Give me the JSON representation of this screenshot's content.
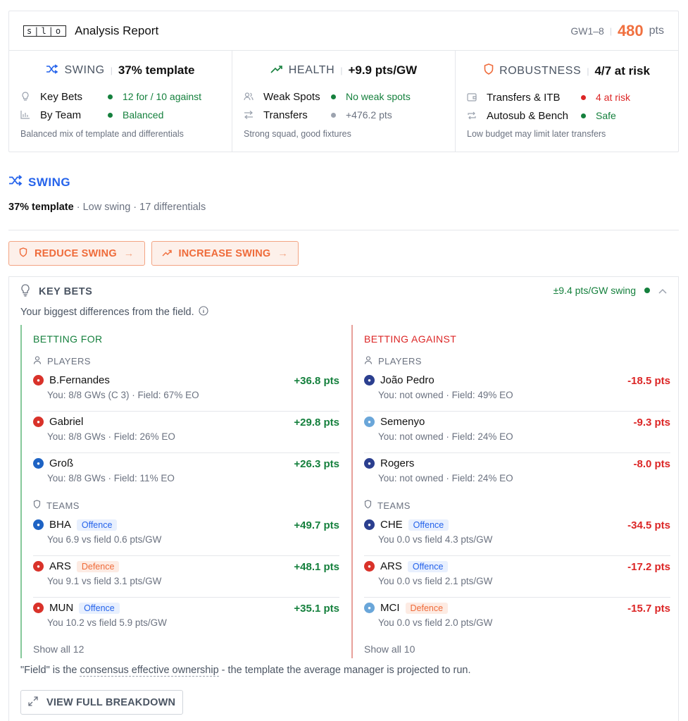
{
  "header": {
    "logo_text": "s|l|o",
    "title": "Analysis Report",
    "gw_range": "GW1–8",
    "points": "480",
    "points_unit": "pts"
  },
  "metrics": [
    {
      "label": "SWING",
      "value": "37% template",
      "color": "#2563eb",
      "rows": [
        {
          "label": "Key Bets",
          "value": "12 for / 10 against",
          "status": "#15803d",
          "value_color": "#15803d"
        },
        {
          "label": "By Team",
          "value": "Balanced",
          "status": "#15803d",
          "value_color": "#15803d"
        }
      ],
      "footer": "Balanced mix of template and differentials"
    },
    {
      "label": "HEALTH",
      "value": "+9.9 pts/GW",
      "color": "#15803d",
      "rows": [
        {
          "label": "Weak Spots",
          "value": "No weak spots",
          "status": "#15803d",
          "value_color": "#15803d"
        },
        {
          "label": "Transfers",
          "value": "+476.2 pts",
          "status": "#9ca3af",
          "value_color": "#6b7280"
        }
      ],
      "footer": "Strong squad, good fixtures"
    },
    {
      "label": "ROBUSTNESS",
      "value": "4/7 at risk",
      "color": "#ef6b3a",
      "rows": [
        {
          "label": "Transfers & ITB",
          "value": "4 at risk",
          "status": "#dc2626",
          "value_color": "#dc2626"
        },
        {
          "label": "Autosub & Bench",
          "value": "Safe",
          "status": "#15803d",
          "value_color": "#15803d"
        }
      ],
      "footer": "Low budget may limit later transfers"
    }
  ],
  "swing_section": {
    "title": "SWING",
    "summary_bold": "37% template",
    "summary_rest": " · Low swing · 17 differentials",
    "reduce_label": "REDUCE SWING",
    "increase_label": "INCREASE SWING"
  },
  "key_bets": {
    "title": "KEY BETS",
    "swing_value": "±9.4 pts/GW swing",
    "description": "Your biggest differences from the field.",
    "for": {
      "heading": "BETTING FOR",
      "players_label": "PLAYERS",
      "players": [
        {
          "name": "B.Fernandes",
          "value": "+36.8 pts",
          "sub": "You: 8/8 GWs (C 3) · Field: 67% EO",
          "crest": "#d9322a"
        },
        {
          "name": "Gabriel",
          "value": "+29.8 pts",
          "sub": "You: 8/8 GWs · Field: 26% EO",
          "crest": "#d9322a"
        },
        {
          "name": "Groß",
          "value": "+26.3 pts",
          "sub": "You: 8/8 GWs · Field: 11% EO",
          "crest": "#1e63c4"
        }
      ],
      "teams_label": "TEAMS",
      "teams": [
        {
          "name": "BHA",
          "tag": "Offence",
          "tag_type": "off",
          "value": "+49.7 pts",
          "sub": "You 6.9 vs field 0.6 pts/GW",
          "crest": "#1e63c4"
        },
        {
          "name": "ARS",
          "tag": "Defence",
          "tag_type": "def",
          "value": "+48.1 pts",
          "sub": "You 9.1 vs field 3.1 pts/GW",
          "crest": "#d9322a"
        },
        {
          "name": "MUN",
          "tag": "Offence",
          "tag_type": "off",
          "value": "+35.1 pts",
          "sub": "You 10.2 vs field 5.9 pts/GW",
          "crest": "#d9322a"
        }
      ],
      "show_all": "Show all 12"
    },
    "against": {
      "heading": "BETTING AGAINST",
      "players_label": "PLAYERS",
      "players": [
        {
          "name": "João Pedro",
          "value": "-18.5 pts",
          "sub": "You: not owned · Field: 49% EO",
          "crest": "#2b3f8f"
        },
        {
          "name": "Semenyo",
          "value": "-9.3 pts",
          "sub": "You: not owned · Field: 24% EO",
          "crest": "#6aa6d9"
        },
        {
          "name": "Rogers",
          "value": "-8.0 pts",
          "sub": "You: not owned · Field: 24% EO",
          "crest": "#2b3f8f"
        }
      ],
      "teams_label": "TEAMS",
      "teams": [
        {
          "name": "CHE",
          "tag": "Offence",
          "tag_type": "off",
          "value": "-34.5 pts",
          "sub": "You 0.0 vs field 4.3 pts/GW",
          "crest": "#2b3f8f"
        },
        {
          "name": "ARS",
          "tag": "Offence",
          "tag_type": "off",
          "value": "-17.2 pts",
          "sub": "You 0.0 vs field 2.1 pts/GW",
          "crest": "#d9322a"
        },
        {
          "name": "MCI",
          "tag": "Defence",
          "tag_type": "def",
          "value": "-15.7 pts",
          "sub": "You 0.0 vs field 2.0 pts/GW",
          "crest": "#6aa6d9"
        }
      ],
      "show_all": "Show all 10"
    },
    "footnote_pre": "\"Field\" is the ",
    "footnote_link": "consensus effective ownership",
    "footnote_post": " - the template the average manager is projected to run.",
    "view_button": "VIEW FULL BREAKDOWN"
  }
}
